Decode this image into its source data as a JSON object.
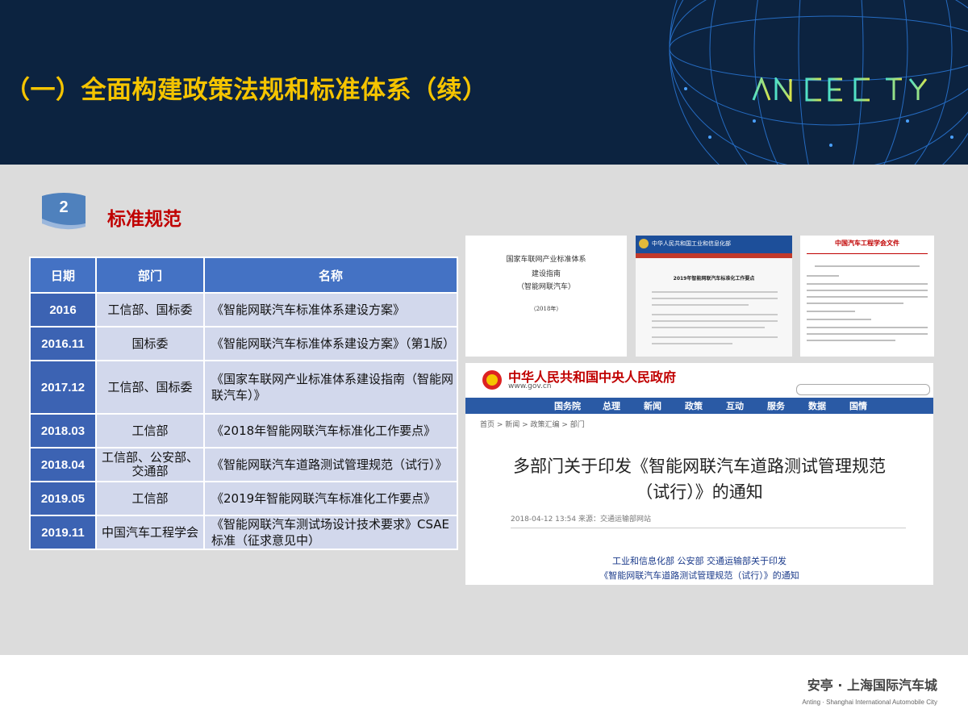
{
  "header": {
    "title": "（一）全面构建政策法规和标准体系（续）",
    "brand_logo_text": "ANICE CITY"
  },
  "section": {
    "number": "2",
    "title": "标准规范"
  },
  "table": {
    "headers": [
      "日期",
      "部门",
      "名称"
    ],
    "rows": [
      {
        "date": "2016",
        "dept": "工信部、国标委",
        "name": "《智能网联汽车标准体系建设方案》"
      },
      {
        "date": "2016.11",
        "dept": "国标委",
        "name": "《智能网联汽车标准体系建设方案》（第1版）"
      },
      {
        "date": "2017.12",
        "dept": "工信部、国标委",
        "name": "《国家车联网产业标准体系建设指南（智能网联汽车）》"
      },
      {
        "date": "2018.03",
        "dept": "工信部",
        "name": "《2018年智能网联汽车标准化工作要点》"
      },
      {
        "date": "2018.04",
        "dept": "工信部、公安部、交通部",
        "name": "《智能网联汽车道路测试管理规范（试行）》"
      },
      {
        "date": "2019.05",
        "dept": "工信部",
        "name": "《2019年智能网联汽车标准化工作要点》"
      },
      {
        "date": "2019.11",
        "dept": "中国汽车工程学会",
        "name": "《智能网联汽车测试场设计技术要求》CSAE标准（征求意见中）"
      }
    ]
  },
  "docs": {
    "doc1": {
      "line1": "国家车联网产业标准体系",
      "line2": "建设指南",
      "line3": "（智能网联汽车）",
      "line4": "（2018年）"
    },
    "doc2": {
      "header": "中华人民共和国工业和信息化部",
      "headline": "2019年智能网联汽车标准化工作要点"
    },
    "doc3": {
      "header": "中国汽车工程学会文件"
    },
    "gov": {
      "site_name": "中华人民共和国中央人民政府",
      "url": "www.gov.cn",
      "nav": [
        "国务院",
        "总理",
        "新闻",
        "政策",
        "互动",
        "服务",
        "数据",
        "国情"
      ],
      "breadcrumb": "首页 > 新闻 > 政策汇编 > 部门",
      "headline_1": "多部门关于印发《智能网联汽车道路测试管理规范",
      "headline_2": "（试行）》的通知",
      "meta": "2018-04-12 13:54   来源：交通运输部网站",
      "body_1": "工业和信息化部 公安部 交通运输部关于印发",
      "body_2": "《智能网联汽车道路测试管理规范（试行）》的通知"
    }
  },
  "footer": {
    "cn": "安亭 · 上海国际汽车城",
    "en": "Anting · Shanghai International Automobile City"
  },
  "colors": {
    "header_bg": "#0c2340",
    "title_yellow": "#f5c400",
    "table_header": "#4472c4",
    "date_cell": "#3c63b3",
    "cell_bg": "#d2d8ec",
    "section_red": "#c00000"
  }
}
